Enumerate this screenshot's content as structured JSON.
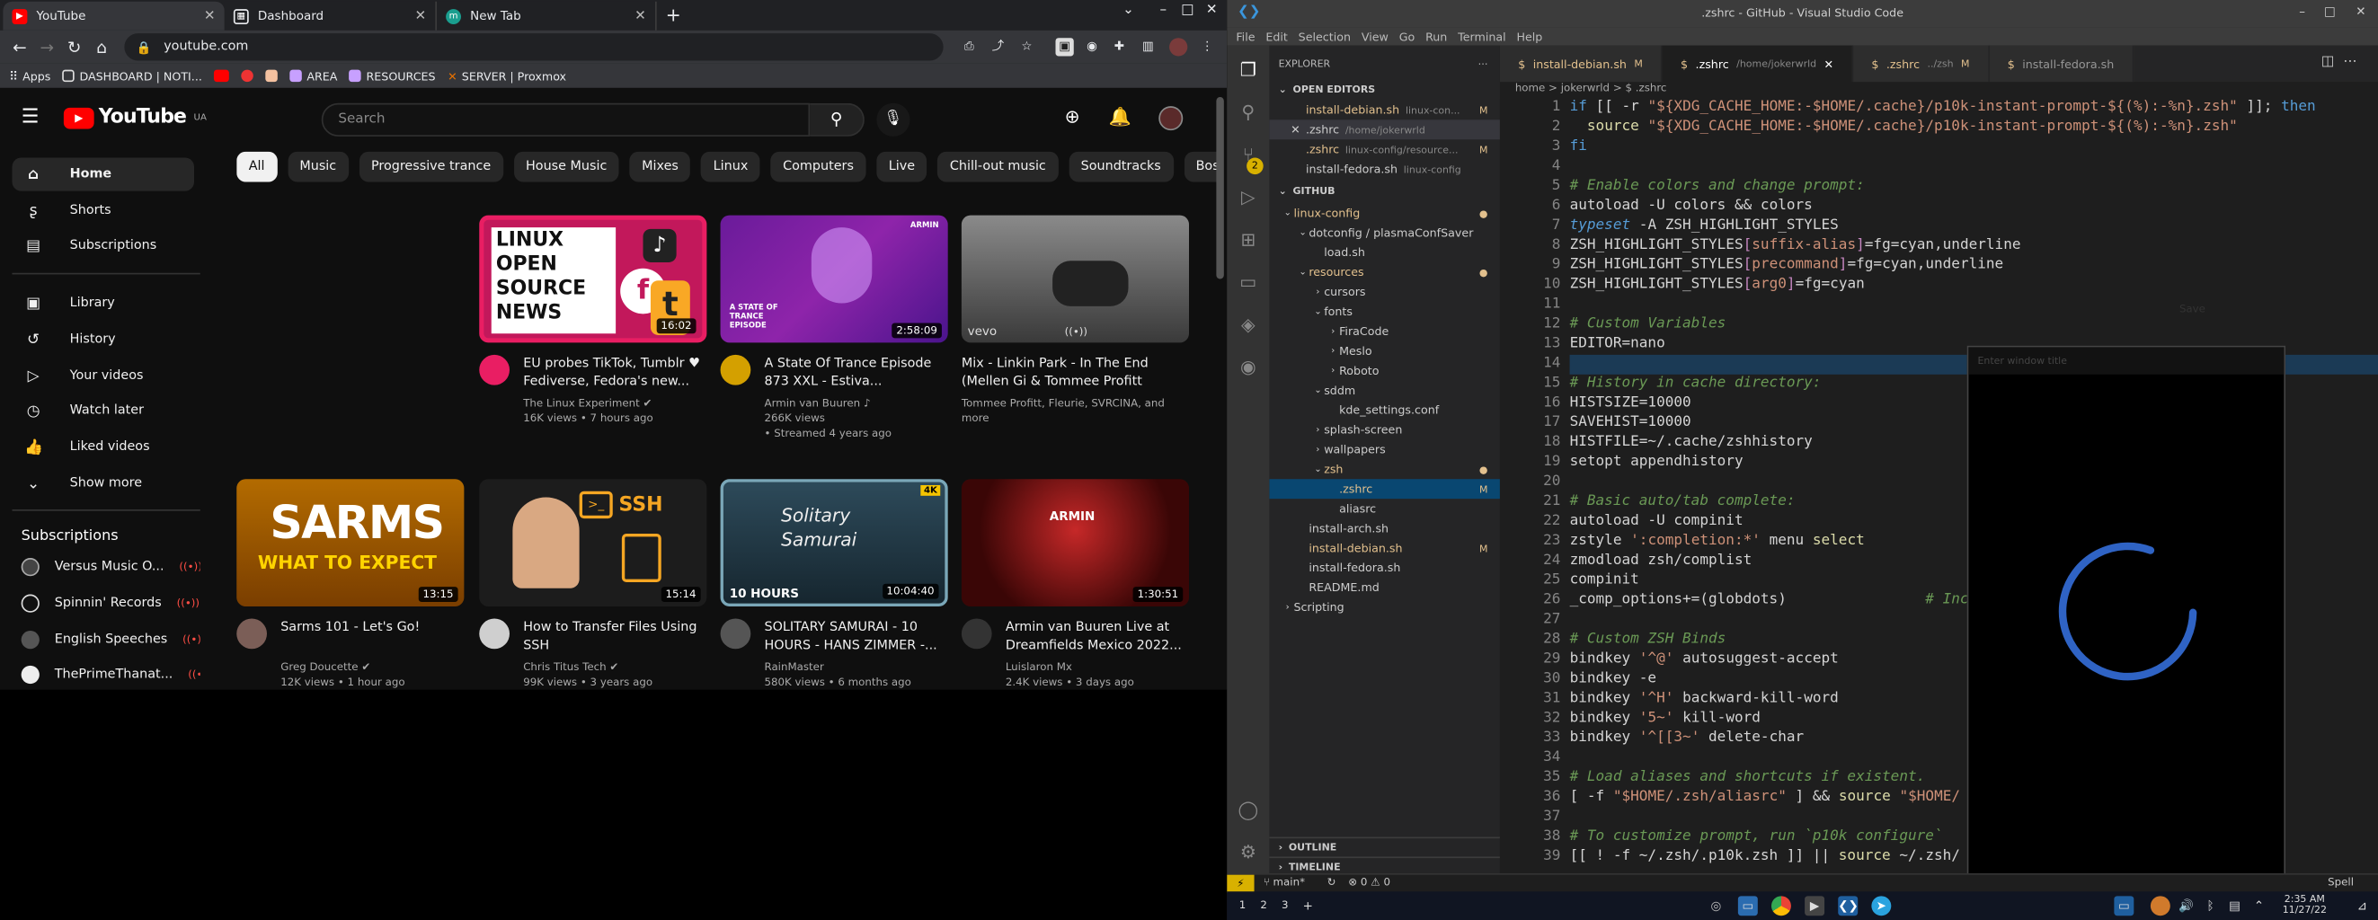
{
  "chrome": {
    "tabs": [
      {
        "title": "YouTube",
        "icon": "youtube-icon",
        "color": "#ff0000"
      },
      {
        "title": "Dashboard",
        "icon": "dashboard-icon",
        "color": "#e8eaed"
      },
      {
        "title": "New Tab",
        "icon": "newtab-icon",
        "color": "#1a9e8f"
      }
    ],
    "url": "youtube.com",
    "bookmarks": [
      "Apps",
      "DASHBOARD | NOTI...",
      "AREA",
      "RESOURCES",
      "SERVER | Proxmox"
    ]
  },
  "youtube": {
    "country": "UA",
    "logo_text": "YouTube",
    "search_placeholder": "Search",
    "sidebar": {
      "main": [
        "Home",
        "Shorts",
        "Subscriptions"
      ],
      "library": [
        "Library",
        "History",
        "Your videos",
        "Watch later",
        "Liked videos",
        "Show more"
      ],
      "subs_title": "Subscriptions",
      "subscriptions": [
        "Versus Music O...",
        "Spinnin' Records",
        "English Speeches",
        "ThePrimeThanat..."
      ]
    },
    "chips": [
      "All",
      "Music",
      "Progressive trance",
      "House Music",
      "Mixes",
      "Linux",
      "Computers",
      "Live",
      "Chill-out music",
      "Soundtracks",
      "Bossa Nova"
    ],
    "videos": [
      {
        "title": "EU probes TikTok, Tumblr ♥ Fediverse, Fedora's new...",
        "channel": "The Linux Experiment",
        "stats": "16K views • 7 hours ago",
        "extra": "",
        "duration": "16:02"
      },
      {
        "title": "A State Of Trance Episode 873 XXL - Estiva...",
        "channel": "Armin van Buuren",
        "stats": "266K views",
        "extra": "• Streamed 4 years ago",
        "duration": "2:58:09"
      },
      {
        "title": "Mix - Linkin Park - In The End (Mellen Gi & Tommee Profitt Remix...",
        "channel": "Tommee Profitt, Fleurie, SVRCINA, and more",
        "stats": "",
        "extra": "",
        "duration": ""
      },
      {
        "title": "Sarms 101 - Let's Go!",
        "channel": "Greg Doucette",
        "stats": "12K views • 1 hour ago",
        "extra": "",
        "duration": "13:15"
      },
      {
        "title": "How to Transfer Files Using SSH",
        "channel": "Chris Titus Tech",
        "stats": "99K views • 3 years ago",
        "extra": "",
        "duration": "15:14"
      },
      {
        "title": "SOLITARY SAMURAI - 10 HOURS - HANS ZIMMER -...",
        "channel": "RainMaster",
        "stats": "580K views • 6 months ago",
        "extra": "",
        "duration": "10:04:40"
      },
      {
        "title": "Armin van Buuren Live at Dreamfields Mexico 2022...",
        "channel": "Luislaron Mx",
        "stats": "2.4K views • 3 days ago",
        "extra": "",
        "duration": "1:30:51"
      }
    ],
    "thumb_text": {
      "linux": [
        "LINUX",
        "OPEN",
        "SOURCE",
        "NEWS"
      ],
      "asot": "A STATE OF TRANCE EPISODE",
      "vevo": "vevo",
      "sarms": "SARMS",
      "sarms_sub": "WHAT TO EXPECT",
      "ssh": "SSH",
      "samurai": "Solitary Samurai",
      "tenh": "10 HOURS",
      "badge4k": "4K",
      "armin": "ARMIN"
    }
  },
  "vscode": {
    "title": ".zshrc - GitHub - Visual Studio Code",
    "menu": [
      "File",
      "Edit",
      "Selection",
      "View",
      "Go",
      "Run",
      "Terminal",
      "Help"
    ],
    "scm_badge": "2",
    "explorer_title": "EXPLORER",
    "open_editors_title": "OPEN EDITORS",
    "open_editors": [
      {
        "name": "install-debian.sh",
        "path": "linux-con...",
        "mark": "M"
      },
      {
        "name": ".zshrc",
        "path": "/home/jokerwrld",
        "mark": ""
      },
      {
        "name": ".zshrc",
        "path": "linux-config/resource...",
        "mark": "M"
      },
      {
        "name": "install-fedora.sh",
        "path": "linux-config",
        "mark": ""
      }
    ],
    "github_title": "GITHUB",
    "tree": [
      {
        "label": "linux-config",
        "d": 0,
        "type": "open"
      },
      {
        "label": "dotconfig / plasmaConfSaver",
        "d": 1,
        "type": "open"
      },
      {
        "label": "load.sh",
        "d": 2,
        "type": "file"
      },
      {
        "label": "resources",
        "d": 1,
        "type": "open"
      },
      {
        "label": "cursors",
        "d": 2,
        "type": "closed"
      },
      {
        "label": "fonts",
        "d": 2,
        "type": "open"
      },
      {
        "label": "FiraCode",
        "d": 3,
        "type": "closed"
      },
      {
        "label": "Meslo",
        "d": 3,
        "type": "closed"
      },
      {
        "label": "Roboto",
        "d": 3,
        "type": "closed"
      },
      {
        "label": "sddm",
        "d": 2,
        "type": "open"
      },
      {
        "label": "kde_settings.conf",
        "d": 3,
        "type": "file"
      },
      {
        "label": "splash-screen",
        "d": 2,
        "type": "closed"
      },
      {
        "label": "wallpapers",
        "d": 2,
        "type": "closed"
      },
      {
        "label": "zsh",
        "d": 2,
        "type": "open"
      },
      {
        "label": ".zshrc",
        "d": 3,
        "type": "file"
      },
      {
        "label": "aliasrc",
        "d": 3,
        "type": "file"
      },
      {
        "label": "install-arch.sh",
        "d": 1,
        "type": "file"
      },
      {
        "label": "install-debian.sh",
        "d": 1,
        "type": "file"
      },
      {
        "label": "install-fedora.sh",
        "d": 1,
        "type": "file"
      },
      {
        "label": "README.md",
        "d": 1,
        "type": "file"
      },
      {
        "label": "Scripting",
        "d": 0,
        "type": "closed"
      }
    ],
    "outline_title": "OUTLINE",
    "timeline_title": "TIMELINE",
    "tabs": [
      {
        "name": "install-debian.sh",
        "path": "",
        "mark": "M"
      },
      {
        "name": ".zshrc",
        "path": "/home/jokerwrld",
        "mark": ""
      },
      {
        "name": ".zshrc",
        "path": "../zsh",
        "mark": "M"
      },
      {
        "name": "install-fedora.sh",
        "path": "",
        "mark": ""
      }
    ],
    "breadcrumb": "home > jokerwrld > $ .zshrc",
    "line_count": 39,
    "status": {
      "branch": "main*",
      "problems": "⊗ 0 ⚠ 0",
      "spell": "Spell"
    },
    "overlay_placeholder": "Enter window title",
    "ghost_text": "Save"
  },
  "taskbar": {
    "workspaces": [
      "1",
      "2",
      "3"
    ],
    "time": "2:35 AM",
    "date": "11/27/22"
  },
  "code": [
    "<span class='k'>if</span> [[ -r <span class='s'>\"${XDG_CACHE_HOME:-$HOME/.cache}/p10k-instant-prompt-${(%):-%n}.zsh\"</span> ]]; <span class='k'>then</span>",
    "  <span class='fn'>source</span> <span class='s'>\"${XDG_CACHE_HOME:-$HOME/.cache}/p10k-instant-prompt-${(%):-%n}.zsh\"</span>",
    "<span class='k'>fi</span>",
    "",
    "<span class='cm'># Enable colors and change prompt:</span>",
    "autoload -U colors <span class='op'>&amp;&amp;</span> colors",
    "<span class='ty'>typeset</span> -A ZSH_HIGHLIGHT_STYLES",
    "ZSH_HIGHLIGHT_STYLES<span class='o'>[</span><span class='s'>suffix-alias</span><span class='o'>]</span>=fg=cyan,underline",
    "ZSH_HIGHLIGHT_STYLES<span class='o'>[</span><span class='s'>precommand</span><span class='o'>]</span>=fg=cyan,underline",
    "ZSH_HIGHLIGHT_STYLES<span class='o'>[</span><span class='s'>arg0</span><span class='o'>]</span>=fg=cyan",
    "",
    "<span class='cm'># Custom Variables</span>",
    "EDITOR=nano",
    "",
    "<span class='cm'># History in cache directory:</span>",
    "HISTSIZE=10000",
    "SAVEHIST=10000",
    "HISTFILE=~/.cache/zshhistory",
    "setopt appendhistory",
    "",
    "<span class='cm'># Basic auto/tab complete:</span>",
    "autoload -U compinit",
    "zstyle <span class='s'>':completion:*'</span> menu <span class='y'>select</span>",
    "zmodload zsh/complist",
    "compinit",
    "_comp_options+=(globdots)                <span class='cm'># Inc</span>",
    "",
    "<span class='cm'># Custom ZSH Binds</span>",
    "bindkey <span class='s'>'^@'</span> autosuggest-accept",
    "bindkey -e",
    "bindkey <span class='s'>'^H'</span> backward-kill-word",
    "bindkey <span class='s'>'5~'</span> kill-word",
    "bindkey <span class='s'>'^[[3~'</span> delete-char",
    "",
    "<span class='cm'># Load aliases and shortcuts if existent.</span>",
    "[ -f <span class='s'>\"$HOME/.zsh/aliasrc\"</span> ] <span class='op'>&amp;&amp;</span> <span class='fn'>source</span> <span class='s'>\"$HOME/</span>",
    "",
    "<span class='cm'># To customize prompt, run `p10k configure`</span>",
    "[[ ! -f ~/.zsh/.p10k.zsh ]] || <span class='fn'>source</span> ~/.zsh/"
  ]
}
